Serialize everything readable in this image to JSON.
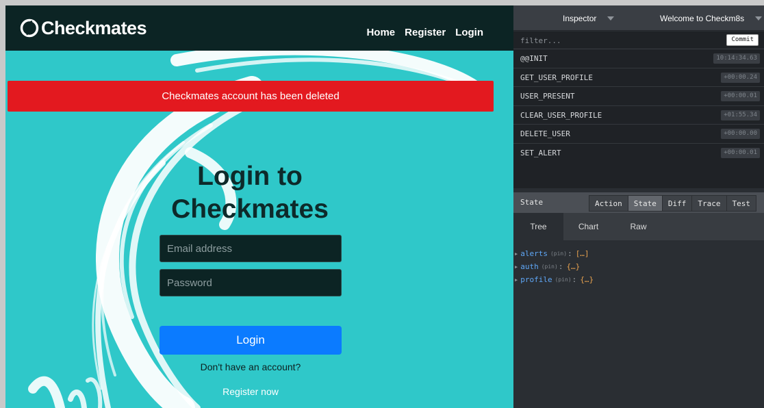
{
  "app": {
    "brand": "Checkmates",
    "nav": [
      "Home",
      "Register",
      "Login"
    ],
    "alert": "Checkmates account has been deleted",
    "title_line1": "Login to",
    "title_line2": "Checkmates",
    "email_placeholder": "Email address",
    "password_placeholder": "Password",
    "login_button": "Login",
    "no_account_text": "Don't have an account?",
    "register_link": "Register now",
    "colors": {
      "navbar": "#0c2424",
      "background": "#2fc8c9",
      "alert": "#e3191f",
      "button": "#0b7bff"
    }
  },
  "devtools": {
    "monitor_select": "Inspector",
    "instance_select": "Welcome to Checkm8s",
    "filter_placeholder": "filter...",
    "commit_label": "Commit",
    "actions": [
      {
        "name": "@@INIT",
        "time": "10:14:34.63"
      },
      {
        "name": "GET_USER_PROFILE",
        "time": "+00:00.24"
      },
      {
        "name": "USER_PRESENT",
        "time": "+00:00.01"
      },
      {
        "name": "CLEAR_USER_PROFILE",
        "time": "+01:55.34"
      },
      {
        "name": "DELETE_USER",
        "time": "+00:00.00"
      },
      {
        "name": "SET_ALERT",
        "time": "+00:00.01"
      }
    ],
    "state_label": "State",
    "monitor_tabs": [
      "Action",
      "State",
      "Diff",
      "Trace",
      "Test"
    ],
    "active_monitor_tab": "State",
    "view_tabs": [
      "Tree",
      "Chart",
      "Raw"
    ],
    "active_view_tab": "Tree",
    "tree": [
      {
        "key": "alerts",
        "pin": "(pin)",
        "value": "[…]"
      },
      {
        "key": "auth",
        "pin": "(pin)",
        "value": "{…}"
      },
      {
        "key": "profile",
        "pin": "(pin)",
        "value": "{…}"
      }
    ]
  }
}
